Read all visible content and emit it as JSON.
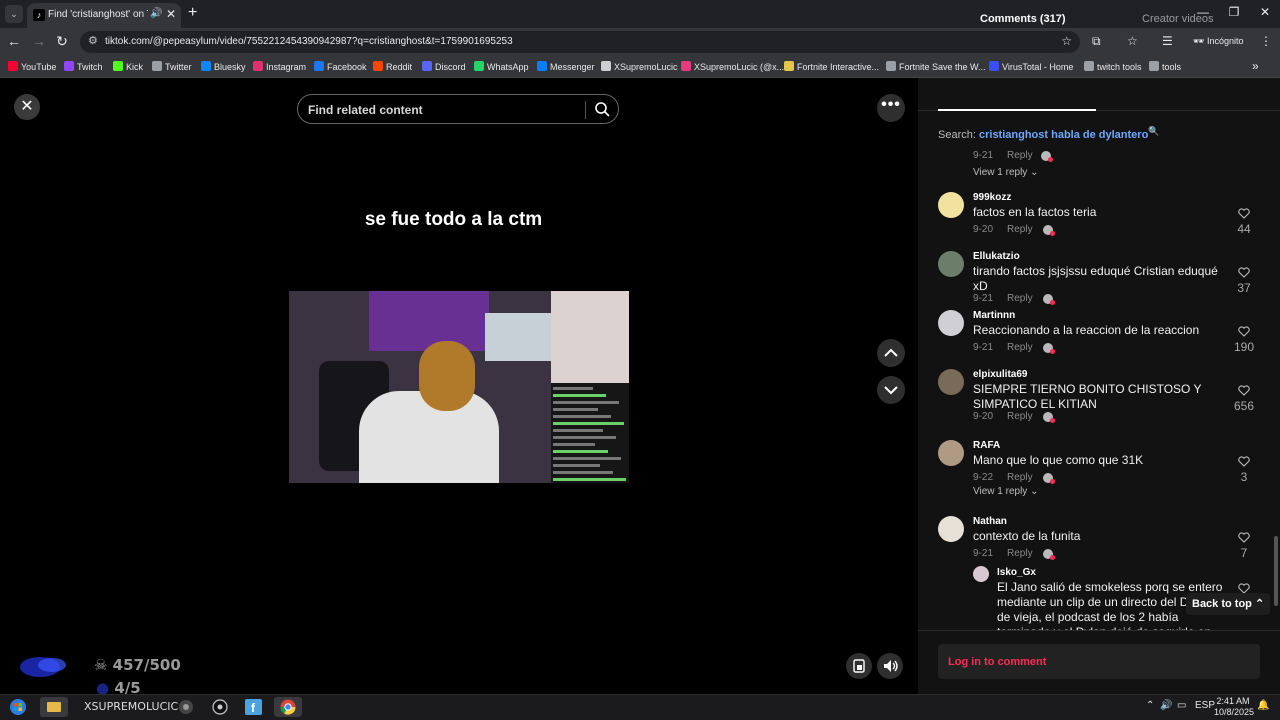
{
  "browser": {
    "tab_title": "Find 'cristianghost' on TikTok",
    "tab_close": "✕",
    "new_tab": "+",
    "url": "tiktok.com/@pepeasylum/video/7552212454390942987?q=cristianghost&t=1759901695253",
    "profile_label": "Incógnito",
    "bookmarks": [
      {
        "label": "YouTube",
        "color": "#ff0033"
      },
      {
        "label": "Twitch",
        "color": "#9146ff"
      },
      {
        "label": "Kick",
        "color": "#53fc18"
      },
      {
        "label": "Twitter",
        "color": "#9aa0a6"
      },
      {
        "label": "Bluesky",
        "color": "#1185fe"
      },
      {
        "label": "Instagram",
        "color": "#e1306c"
      },
      {
        "label": "Facebook",
        "color": "#1877f2"
      },
      {
        "label": "Reddit",
        "color": "#ff4500"
      },
      {
        "label": "Discord",
        "color": "#5865f2"
      },
      {
        "label": "WhatsApp",
        "color": "#25d366"
      },
      {
        "label": "Messenger",
        "color": "#0a7cff"
      },
      {
        "label": "XSupremoLucic",
        "color": "#cfcfcf"
      },
      {
        "label": "XSupremoLucic (@x...",
        "color": "#e33b7c"
      },
      {
        "label": "Fortnite Interactive...",
        "color": "#e5c64a"
      },
      {
        "label": "Fortnite Save the W...",
        "color": "#9aa0a6"
      },
      {
        "label": "VirusTotal - Home",
        "color": "#394eff"
      },
      {
        "label": "twitch tools",
        "color": "#9aa0a6"
      },
      {
        "label": "tools",
        "color": "#9aa0a6"
      }
    ],
    "bookmarks_overflow": "»"
  },
  "video": {
    "search_placeholder": "Find related content",
    "caption": "se fue todo a la ctm",
    "close_icon": "✕",
    "more_icon": "•••"
  },
  "obs_overlay": {
    "stat1": "457/500",
    "stat2": "4/5"
  },
  "comments_panel": {
    "tab_comments": "Comments (317)",
    "tab_creator": "Creator videos",
    "search_prefix": "Search:",
    "search_query": "cristianghost habla de dylantero",
    "reply_label": "Reply",
    "top_meta_date": "9-21",
    "top_view_replies": "View 1 reply",
    "comments": [
      {
        "user": "999kozz",
        "text": "factos en la factos teria",
        "date": "9-20",
        "likes": "44"
      },
      {
        "user": "Ellukatzio",
        "text": "tirando factos jsjsjssu eduqué Cristian eduqué xD",
        "date": "9-21",
        "likes": "37"
      },
      {
        "user": "Martinnn",
        "text": "Reaccionando a la reaccion de la reaccion",
        "date": "9-21",
        "likes": "190"
      },
      {
        "user": "elpixulita69",
        "text": "SIEMPRE TIERNO BONITO CHISTOSO Y SIMPATICO EL KITIAN",
        "date": "9-20",
        "likes": "656"
      },
      {
        "user": "RAFA",
        "text": "Mano que lo que como que 31K",
        "date": "9-22",
        "likes": "3",
        "view_replies": "View 1 reply"
      },
      {
        "user": "Nathan",
        "text": "contexto de la funita",
        "date": "9-21",
        "likes": "7"
      }
    ],
    "reply": {
      "user": "Isko_Gx",
      "text": "El Jano salió de smokeless porq se entero mediante un clip de un directo del Dylan de vieja, el podcast de los 2 había terminado y el Dylan dejó de seguirlo en todas las redes"
    },
    "back_to_top": "Back to top",
    "login": "Log in to comment"
  },
  "taskbar": {
    "app_label": "XSUPREMOLUCIC",
    "language": "ESP",
    "time": "2:41 AM",
    "date": "10/8/2025"
  }
}
